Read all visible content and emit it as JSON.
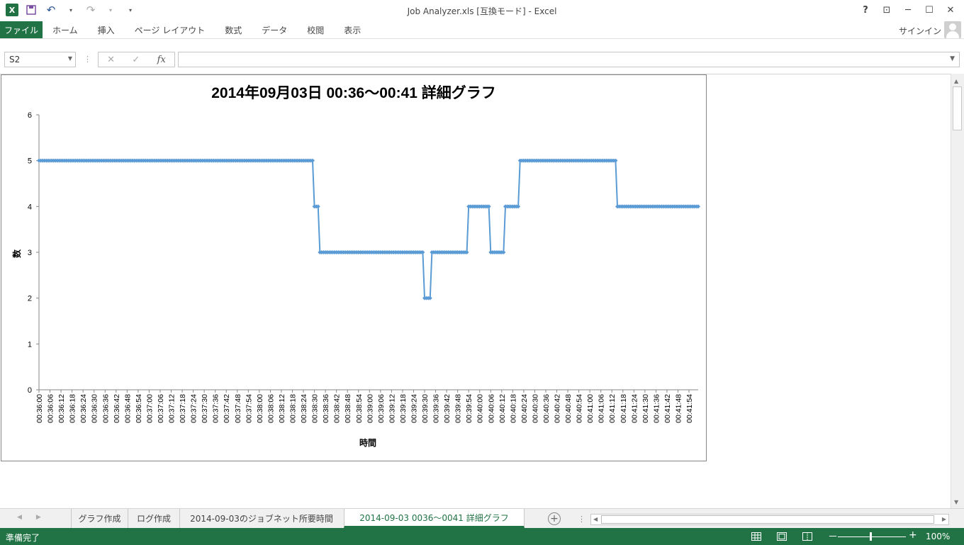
{
  "window": {
    "title": "Job Analyzer.xls  [互換モード] - Excel",
    "excel_logo": "X",
    "help": "?",
    "ribbon_display": "⊡",
    "minimize": "─",
    "restore": "☐",
    "close": "✕"
  },
  "qat": {
    "save_icon": "💾",
    "undo_icon": "↶",
    "redo_icon": "↷",
    "customize": "▾"
  },
  "ribbon": {
    "file_tab": "ファイル",
    "tabs": [
      "ホーム",
      "挿入",
      "ページ レイアウト",
      "数式",
      "データ",
      "校閲",
      "表示"
    ],
    "signin": "サインイン"
  },
  "formula_bar": {
    "name_box": "S2",
    "cancel": "✕",
    "enter": "✓",
    "fx": "fx",
    "content": ""
  },
  "chart_data": {
    "type": "line",
    "title": "2014年09月03日  00:36～00:41  詳細グラフ",
    "xlabel": "時間",
    "ylabel": "数",
    "ylim": [
      0,
      6
    ],
    "yticks": [
      0,
      1,
      2,
      3,
      4,
      5,
      6
    ],
    "x_start": "00:36:00",
    "x_end": "00:41:59",
    "x_step_seconds": 1,
    "x_tick_labels": [
      "00:36:00",
      "00:36:06",
      "00:36:12",
      "00:36:18",
      "00:36:24",
      "00:36:30",
      "00:36:36",
      "00:36:42",
      "00:36:48",
      "00:36:54",
      "00:37:00",
      "00:37:06",
      "00:37:12",
      "00:37:18",
      "00:37:24",
      "00:37:30",
      "00:37:36",
      "00:37:42",
      "00:37:48",
      "00:37:54",
      "00:38:00",
      "00:38:06",
      "00:38:12",
      "00:38:18",
      "00:38:24",
      "00:38:30",
      "00:38:36",
      "00:38:42",
      "00:38:48",
      "00:38:54",
      "00:39:00",
      "00:39:06",
      "00:39:12",
      "00:39:18",
      "00:39:24",
      "00:39:30",
      "00:39:36",
      "00:39:42",
      "00:39:48",
      "00:39:54",
      "00:40:00",
      "00:40:06",
      "00:40:12",
      "00:40:18",
      "00:40:24",
      "00:40:30",
      "00:40:36",
      "00:40:42",
      "00:40:48",
      "00:40:54",
      "00:41:00",
      "00:41:06",
      "00:41:12",
      "00:41:18",
      "00:41:24",
      "00:41:30",
      "00:41:36",
      "00:41:42",
      "00:41:48",
      "00:41:54"
    ],
    "segments": [
      {
        "from": "00:36:00",
        "to": "00:38:29",
        "value": 5
      },
      {
        "from": "00:38:30",
        "to": "00:38:32",
        "value": 4
      },
      {
        "from": "00:38:33",
        "to": "00:39:29",
        "value": 3
      },
      {
        "from": "00:39:30",
        "to": "00:39:33",
        "value": 2
      },
      {
        "from": "00:39:34",
        "to": "00:39:53",
        "value": 3
      },
      {
        "from": "00:39:54",
        "to": "00:40:05",
        "value": 4
      },
      {
        "from": "00:40:06",
        "to": "00:40:13",
        "value": 3
      },
      {
        "from": "00:40:14",
        "to": "00:40:21",
        "value": 4
      },
      {
        "from": "00:40:22",
        "to": "00:41:14",
        "value": 5
      },
      {
        "from": "00:41:15",
        "to": "00:41:59",
        "value": 4
      }
    ],
    "line_color": "#5B9BD5",
    "legend": "none",
    "grid": false
  },
  "sheets": {
    "nav_prev": "◀",
    "nav_next": "▶",
    "tabs": [
      "グラフ作成",
      "ログ作成",
      "2014-09-03のジョブネット所要時間",
      "2014-09-03 0036～0041 詳細グラフ"
    ],
    "active_index": 3,
    "add": "+",
    "more": "⋮"
  },
  "status": {
    "ready": "準備完了",
    "zoom": "100%",
    "zoom_minus": "－",
    "zoom_plus": "+"
  }
}
